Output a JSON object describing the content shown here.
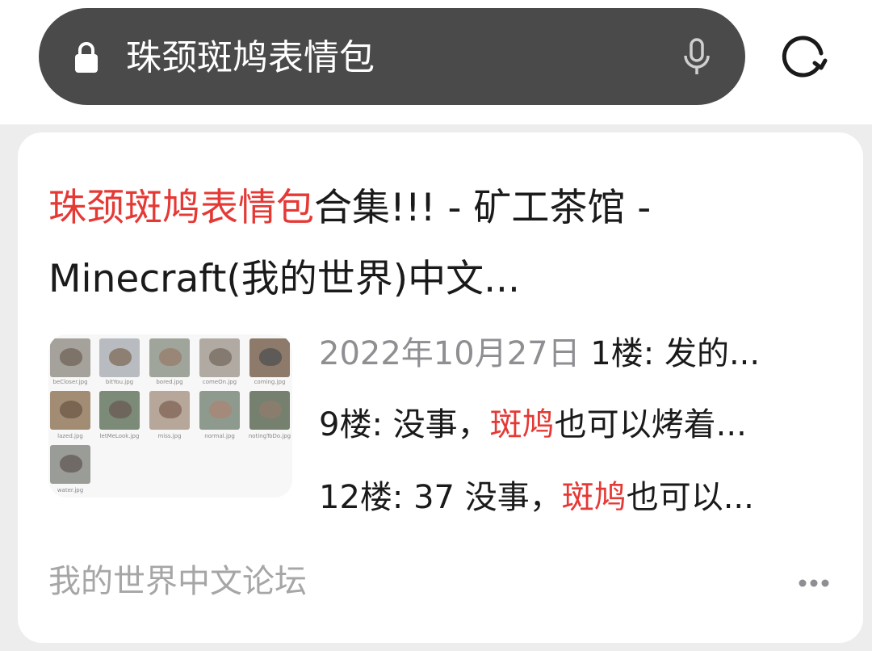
{
  "search_bar": {
    "query": "珠颈斑鸠表情包",
    "lock_icon": "lock-icon",
    "mic_icon": "mic-icon",
    "refresh_icon": "refresh-icon"
  },
  "result": {
    "title_highlight": "珠颈斑鸠表情包",
    "title_rest_line1": "合集!!! - 矿工茶馆 -",
    "title_line2": "Minecraft(我的世界)中文...",
    "snippets": {
      "date": "2022年10月27日",
      "line1_rest": " 1楼: 发的...",
      "line2_prefix": "9楼: 没事，",
      "line2_highlight": "斑鸠",
      "line2_suffix": "也可以烤着...",
      "line3_prefix": "12楼: 37 没事，",
      "line3_highlight": "斑鸠",
      "line3_suffix": "也可以..."
    },
    "thumbnail_labels": [
      "beCloser.jpg",
      "bitYou.jpg",
      "bored.jpg",
      "comeOn.jpg",
      "coming.jpg",
      "lazed.jpg",
      "letMeLook.jpg",
      "miss.jpg",
      "normal.jpg",
      "notingToDo.jpg",
      "water.jpg"
    ],
    "source": "我的世界中文论坛",
    "more_icon": "more-dots-icon"
  },
  "colors": {
    "highlight": "#e53935",
    "search_pill": "#4a4a4a",
    "page_bg": "#ededed",
    "muted_text": "#8e8e93",
    "source_text": "#a6a6a6"
  }
}
